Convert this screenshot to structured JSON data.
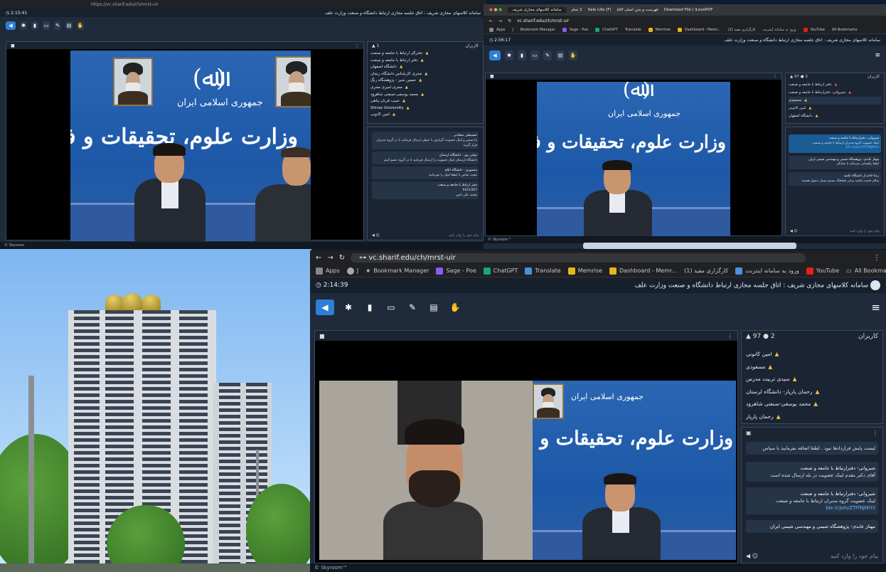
{
  "panel_a": {
    "url": "https://vc.sharif.edu/ch/mrst-uir",
    "window_title": "سامانه کلاسهای مجازی شریف : اتاق جلسه مجازی ارتباط دانشگاه و صنعت وزارت علف",
    "timer": "2:15:41",
    "video_header_right": "⋮",
    "users_count": "1",
    "users_label": "کاربران",
    "users": [
      "دفترکل ارتباط با جامعه و صنعت",
      "دفتر ارتباط با جامعه و صنعت",
      "دانشگاه اصفهان",
      "مجری کارشناس دانشگاه زنجان",
      "حسین شیر - پژوهشگاه رنگ",
      "مجری امیری مجری",
      "محمد یوسفی-صنعتی شاهرود",
      "حبیب قربان پناهی",
      "Shiraz University",
      "امین کانونی"
    ],
    "chat": [
      {
        "name": "حسینعلی سعادتی",
        "text": "ما ضمیر و لینک عضویت گزارش با عنوان ارسال فرمائید تا در گروه مدیران قرار گیرند"
      },
      {
        "name": "دولتی پور - دانشگاه لرستان",
        "text": "دانشگاه لرستان لینک عضویت را ارسال فرمایید تا در گروه عضو کنیم"
      },
      {
        "name": "منصوری - دانشگاه ایلام",
        "text": "مجدد تماس با لطفا لینک را بفرمایید"
      },
      {
        "name": "دفتر ارتباط با جامعه و صنعت",
        "text": "9211067"
      },
      {
        "name": "",
        "text": "محمد علی امین"
      }
    ],
    "chat_input": "پیام خود را وارد کنید",
    "footer": "© Skyroom"
  },
  "panel_b": {
    "tabs": [
      "سامانه کلاسهای مجازی شریف",
      "2 تمام",
      "Sale Lite (F)",
      "فهرست و متن اصلی pdf",
      "Download File | iLovePDF"
    ],
    "url": "vc.sharif.edu/ch/mrst-uir",
    "bookmarks": [
      "Apps",
      "J",
      "Bookmark Manager",
      "Sage - Poe",
      "ChatGPT",
      "Translate",
      "Memrise",
      "Dashboard - Memr...",
      "کارگزاری مفید (1)",
      "ورود به سامانه اینترنت",
      "YouTube",
      "All Bookmarks"
    ],
    "window_title": "سامانه کلاسهای مجازی شریف : اتاق جلسه مجازی ارتباط دانشگاه و صنعت وزارت علف",
    "timer": "2:56:17",
    "users_count": "97",
    "online_count": "3",
    "users_label": "کاربران",
    "users": [
      "دفتر ارتباط با جامعه و صنعت",
      "شیروانی- دفترارتباط با جامعه و صنعت",
      "مسعودی",
      "امین کانونی",
      "دانشگاه اصفهان"
    ],
    "chat": [
      {
        "name": "شیروانی- دفترارتباط با جامعه و صنعت",
        "text": "لینک عضویت گروه مدیران ارتباط با جامعه و صنعت",
        "link": "ble.ir/join/ZTFfNjMIYz"
      },
      {
        "name": "مهتاز عابدی- پژوهشگاه شیمی و مهندسی شیمی ایران",
        "text": "لطفا راهنمایی بفرمائید یا نشانگر"
      },
      {
        "name": "رضا خادم از دانشگاه علمیه",
        "text": "سلام خسته نباشید برخی هماهنگ بیستم بسیار دشوار هستند"
      }
    ],
    "chat_input": "پیام خود را وارد کنید",
    "footer": "© Skyroom™"
  },
  "panel_c": {
    "url": "vc.sharif.edu/ch/mrst-uir",
    "bookmarks": [
      "Apps",
      "J",
      "Bookmark Manager",
      "Sage - Poe",
      "ChatGPT",
      "Translate",
      "Memrise",
      "Dashboard - Memr...",
      "کارگزاری مفید (1)",
      "ورود به سامانه اینترنت",
      "YouTube",
      "All Bookmarks"
    ],
    "window_title": "سامانه کلاسهای مجازی شریف : اتاق جلسه مجازی ارتباط دانشگاه و صنعت وزارت علف",
    "timer": "2:14:39",
    "users_count": "97",
    "online_count": "2",
    "users_label": "کاربران",
    "users": [
      "امین کانونی",
      "مسعودی",
      "سیدی تربیت مدرس",
      "رحمان پارپار- دانشگاه لرستان",
      "محمد یوسفی-صنعتی شاهرود",
      "رحمان پارپار"
    ],
    "chat": [
      {
        "name": "",
        "text": "لیست پایش قراردادها نبود . لطفا اضافه بفرمایید با سپاس"
      },
      {
        "name": "شیروانی- دفترارتباط با جامعه و صنعت",
        "text": "آقای دکتر مقدم لینک عضویت در بله ارسال شده است"
      },
      {
        "name": "شیروانی- دفترارتباط با جامعه و صنعت",
        "text": "لینک عضویت گروه مدیران ارتباط با جامعه و صنعت",
        "link": "ble.ir/join/ZTFfNjMIYz"
      },
      {
        "name": "مهتاز عابدی- پژوهشگاه شیمی و مهندسی شیمی ایران",
        "text": ""
      }
    ],
    "chat_input": "پیام خود را وارد کنید",
    "footer": "© Skyroom™"
  },
  "scene": {
    "emblem": "(ﷲ)",
    "republic": "جمهوری اسلامی ایران",
    "ministry": "وزارت علوم، تحقیقات و فناوری"
  },
  "colors": {
    "accent": "#2f7fd8",
    "panel_bg": "#1f2a3a",
    "scene_blue": "#1d58a8",
    "user_icon": "#f2c14e"
  }
}
